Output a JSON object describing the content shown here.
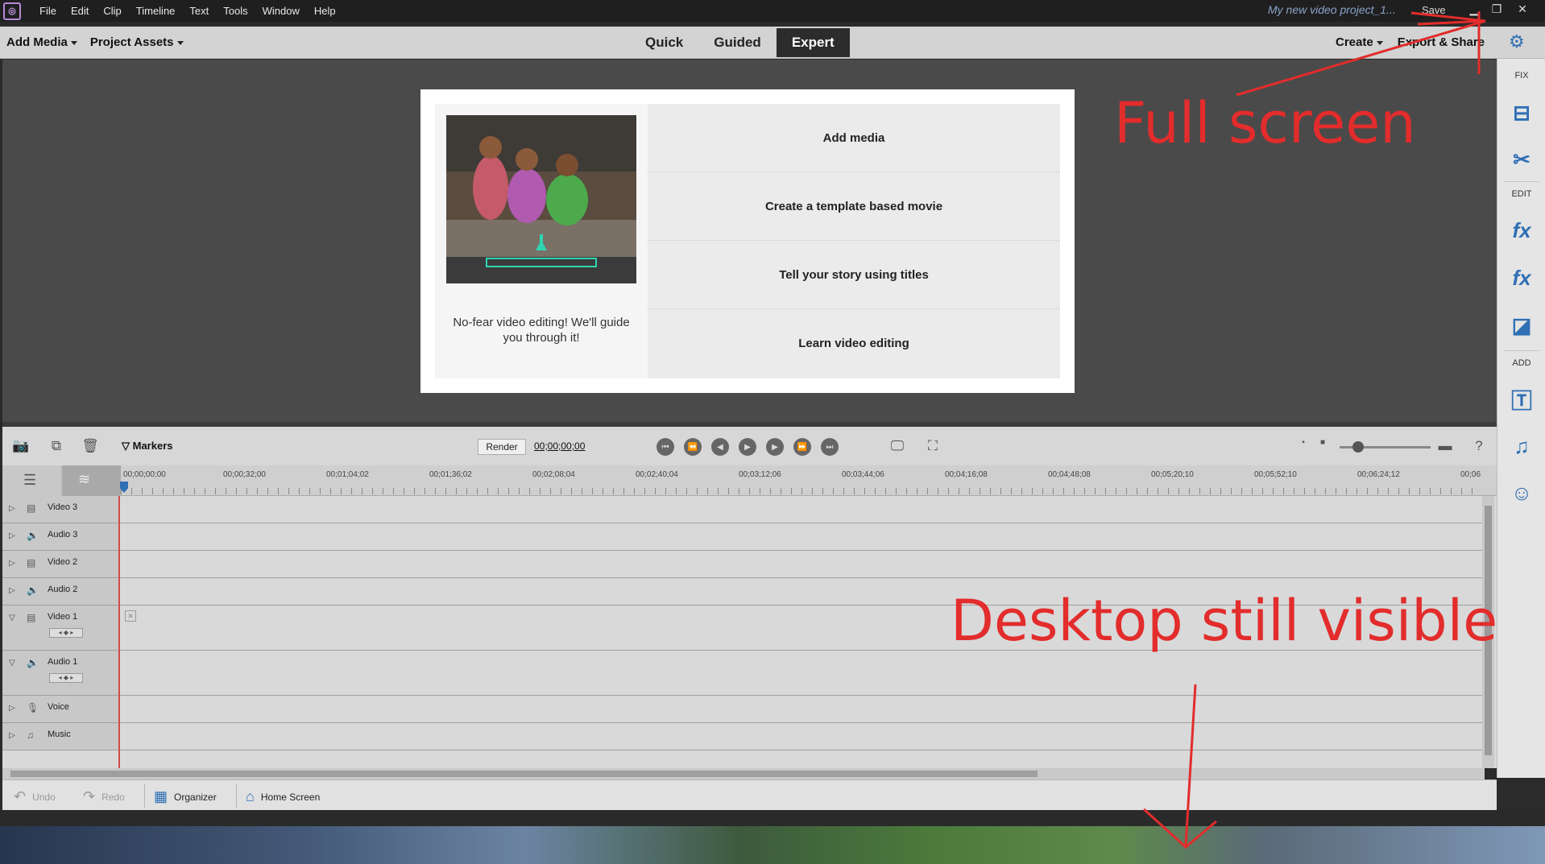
{
  "menubar": {
    "items": [
      "File",
      "Edit",
      "Clip",
      "Timeline",
      "Text",
      "Tools",
      "Window",
      "Help"
    ],
    "project_title": "My new video project_1...",
    "save_label": "Save"
  },
  "toolbar": {
    "add_media": "Add Media",
    "project_assets": "Project Assets",
    "tabs": [
      "Quick",
      "Guided",
      "Expert"
    ],
    "active_tab": "Expert",
    "create": "Create",
    "export_share": "Export & Share"
  },
  "right_panel": {
    "fix_label": "FIX",
    "edit_label": "EDIT",
    "add_label": "ADD"
  },
  "welcome": {
    "tagline": "No-fear video editing! We'll guide you through it!",
    "options": [
      "Add media",
      "Create a template based movie",
      "Tell your story using titles",
      "Learn video editing"
    ]
  },
  "timeline_controls": {
    "markers_label": "Markers",
    "render_label": "Render",
    "timecode": "00;00;00;00"
  },
  "ruler": {
    "ticks": [
      "00;00;00;00",
      "00;00;32;00",
      "00;01;04;02",
      "00;01;36;02",
      "00;02;08;04",
      "00;02;40;04",
      "00;03;12;06",
      "00;03;44;06",
      "00;04;16;08",
      "00;04;48;08",
      "00;05;20;10",
      "00;05;52;10",
      "00;06;24;12",
      "00;06"
    ]
  },
  "tracks": [
    {
      "name": "Video 3",
      "type": "video",
      "expanded": false
    },
    {
      "name": "Audio 3",
      "type": "audio",
      "expanded": false
    },
    {
      "name": "Video 2",
      "type": "video",
      "expanded": false
    },
    {
      "name": "Audio 2",
      "type": "audio",
      "expanded": false
    },
    {
      "name": "Video 1",
      "type": "video",
      "expanded": true
    },
    {
      "name": "Audio 1",
      "type": "audio",
      "expanded": true
    },
    {
      "name": "Voice",
      "type": "voice",
      "expanded": false
    },
    {
      "name": "Music",
      "type": "music",
      "expanded": false
    }
  ],
  "bottombar": {
    "undo": "Undo",
    "redo": "Redo",
    "organizer": "Organizer",
    "home_screen": "Home Screen"
  },
  "annotations": {
    "full_screen": "Full screen",
    "desktop_visible": "Desktop still visible",
    "color": "#e32c2c"
  }
}
